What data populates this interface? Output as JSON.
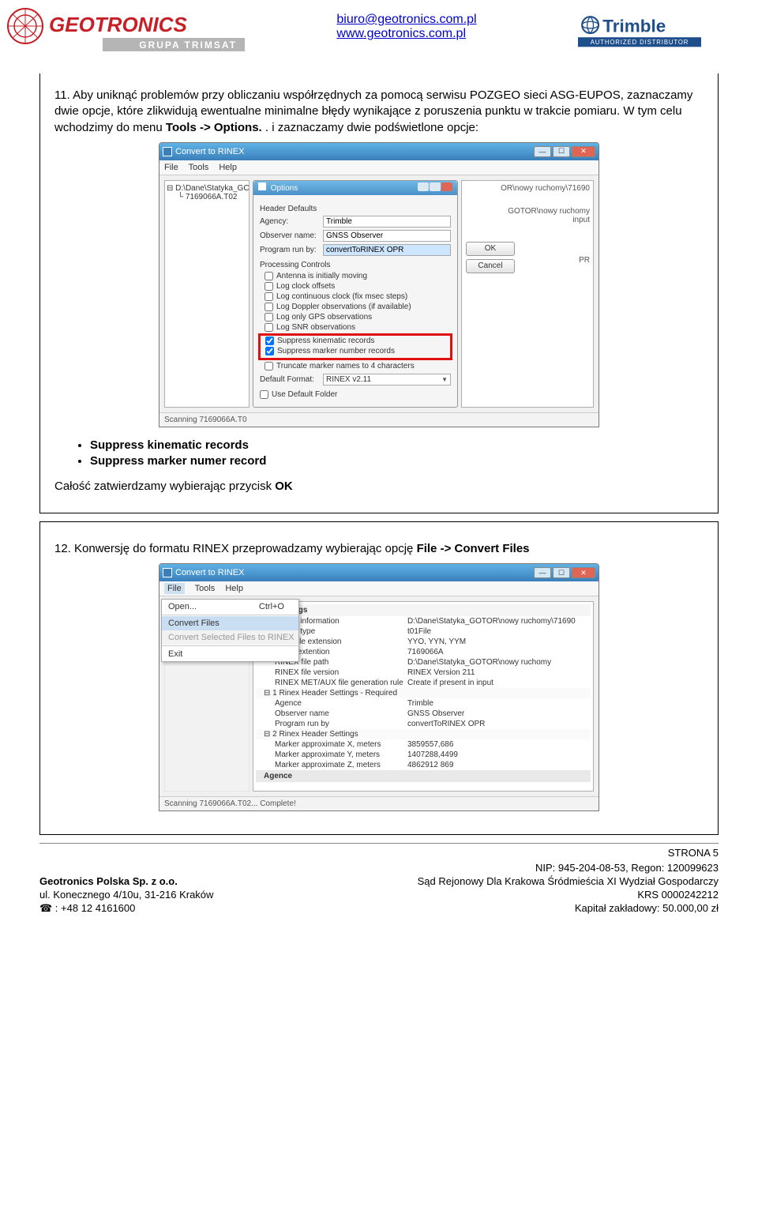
{
  "header": {
    "email": "biuro@geotronics.com.pl",
    "site": "www.geotronics.com.pl",
    "logo_left": {
      "brand": "GEOTRONICS",
      "sub": "GRUPA TRIMSAT"
    },
    "logo_right": {
      "brand": "Trimble",
      "sub": "AUTHORIZED DISTRIBUTOR"
    }
  },
  "section11": {
    "num": "11.",
    "text_a": "Aby uniknąć problemów przy obliczaniu współrzędnych za pomocą serwisu POZGEO sieci ASG-EUPOS, zaznaczamy dwie opcje, które zlikwidują ewentualne minimalne błędy wynikające z poruszenia punktu w trakcie pomiaru. W tym celu wchodzimy do menu ",
    "bold_a": "Tools -> Options.",
    "text_b": ". i zaznaczamy dwie podświetlone opcje:",
    "bullets": [
      "Suppress kinematic records",
      "Suppress marker numer record"
    ],
    "closing_a": "Całość zatwierdzamy wybierając przycisk ",
    "closing_b": "OK"
  },
  "section12": {
    "num": "12.",
    "text_a": "Konwersję do formatu RINEX przeprowadzamy wybierając opcję ",
    "bold_a": "File -> Convert Files"
  },
  "screenshot1": {
    "win_title": "Convert to RINEX",
    "menu": {
      "file": "File",
      "tools": "Tools",
      "help": "Help"
    },
    "tree": {
      "root": "D:\\Dane\\Statyka_GC",
      "child": "7169066A.T02"
    },
    "dialog": {
      "title": "Options",
      "group1": "Header Defaults",
      "agency_label": "Agency:",
      "agency": "Trimble",
      "observer_label": "Observer name:",
      "observer": "GNSS Observer",
      "program_label": "Program run by:",
      "program": "convertToRINEX OPR",
      "group2": "Processing Controls",
      "chk": [
        "Antenna is initially moving",
        "Log clock offsets",
        "Log continuous clock (fix msec steps)",
        "Log Doppler observations (if available)",
        "Log only GPS observations",
        "Log SNR observations",
        "Suppress kinematic records",
        "Suppress marker number records",
        "Truncate marker names to 4 characters"
      ],
      "default_format_label": "Default Format:",
      "default_format": "RINEX v2.11",
      "use_default_folder": "Use Default Folder",
      "ok": "OK",
      "cancel": "Cancel"
    },
    "right": {
      "l1": "OR\\nowy ruchomy\\71690",
      "l2": "GOTOR\\nowy ruchomy",
      "l3": "input",
      "l4": "PR"
    },
    "status": "Scanning 7169066A.T0"
  },
  "screenshot2": {
    "win_title": "Convert to RINEX",
    "menu": {
      "file": "File",
      "tools": "Tools",
      "help": "Help"
    },
    "file_menu": {
      "open": "Open...",
      "open_accel": "Ctrl+O",
      "convert": "Convert Files",
      "convert_sel": "Convert Selected Files to RINEX",
      "exit": "Exit"
    },
    "settings": {
      "header": "File Settings",
      "rows": [
        [
          "put file information",
          "D:\\Dane\\Statyka_GOTOR\\nowy ruchomy\\71690"
        ],
        [
          "put file type",
          "t01File"
        ],
        [
          "INEX file extension",
          "YYO, YYN, YYM"
        ],
        [
          "le w/o extention",
          "7169066A"
        ],
        [
          "RINEX file path",
          "D:\\Dane\\Statyka_GOTOR\\nowy ruchomy"
        ],
        [
          "RINEX file version",
          "RINEX Version 211"
        ],
        [
          "RINEX MET/AUX file generation rule",
          "Create if present in input"
        ]
      ],
      "grp1": "1 Rinex Header Settings - Required",
      "rows1": [
        [
          "Agence",
          "Trimble"
        ],
        [
          "Observer name",
          "GNSS Observer"
        ],
        [
          "Program run by",
          "convertToRINEX OPR"
        ]
      ],
      "grp2": "2 Rinex Header Settings",
      "rows2": [
        [
          "Marker approximate X, meters",
          "3859557,686"
        ],
        [
          "Marker approximate Y, meters",
          "1407288,4499"
        ],
        [
          "Marker approximate Z, meters",
          "4862912 869"
        ]
      ],
      "agence": "Agence"
    },
    "status": "Scanning 7169066A.T02...      Complete!"
  },
  "footer": {
    "page": "STRONA 5",
    "company": "Geotronics Polska Sp. z o.o.",
    "addr": "ul. Konecznego 4/10u, 31-216 Kraków",
    "tel": "☎ : +48 12 4161600",
    "nip": "NIP: 945-204-08-53, Regon: 120099623",
    "court": "Sąd Rejonowy Dla Krakowa Śródmieścia XI Wydział Gospodarczy",
    "krs": "KRS 0000242212",
    "capital": "Kapitał zakładowy: 50.000,00 zł"
  }
}
